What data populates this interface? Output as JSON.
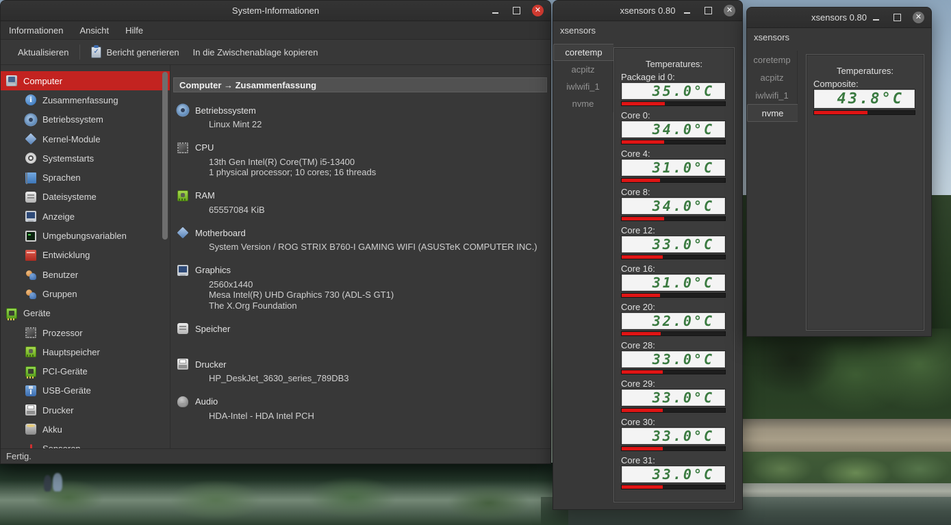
{
  "colors": {
    "accent_red": "#c32320",
    "bar_red": "#e01414",
    "seg_green": "#3a7a40",
    "window_bg": "#383838"
  },
  "main_window": {
    "title": "System-Informationen",
    "menu": [
      "Informationen",
      "Ansicht",
      "Hilfe"
    ],
    "toolbar": {
      "refresh": "Aktualisieren",
      "report": "Bericht generieren",
      "copy": "In die Zwischenablage kopieren"
    },
    "sidebar": [
      {
        "label": "Computer",
        "icon": "computer",
        "indent": 0,
        "selected": true
      },
      {
        "label": "Zusammenfassung",
        "icon": "info",
        "indent": 1
      },
      {
        "label": "Betriebssystem",
        "icon": "gear",
        "indent": 1
      },
      {
        "label": "Kernel-Module",
        "icon": "kernel",
        "indent": 1
      },
      {
        "label": "Systemstarts",
        "icon": "power",
        "indent": 1
      },
      {
        "label": "Sprachen",
        "icon": "lang",
        "indent": 1
      },
      {
        "label": "Dateisysteme",
        "icon": "drive",
        "indent": 1
      },
      {
        "label": "Anzeige",
        "icon": "display",
        "indent": 1
      },
      {
        "label": "Umgebungsvariablen",
        "icon": "terminal",
        "indent": 1
      },
      {
        "label": "Entwicklung",
        "icon": "devel",
        "indent": 1
      },
      {
        "label": "Benutzer",
        "icon": "users",
        "indent": 1
      },
      {
        "label": "Gruppen",
        "icon": "users",
        "indent": 1
      },
      {
        "label": "Geräte",
        "icon": "chip",
        "indent": 0
      },
      {
        "label": "Prozessor",
        "icon": "cpu",
        "indent": 1
      },
      {
        "label": "Hauptspeicher",
        "icon": "ram",
        "indent": 1
      },
      {
        "label": "PCI-Geräte",
        "icon": "chip",
        "indent": 1
      },
      {
        "label": "USB-Geräte",
        "icon": "usb",
        "indent": 1
      },
      {
        "label": "Drucker",
        "icon": "printer",
        "indent": 1
      },
      {
        "label": "Akku",
        "icon": "battery",
        "indent": 1
      },
      {
        "label": "Sensoren",
        "icon": "sensor",
        "indent": 1
      }
    ],
    "content": {
      "header": "Computer → Zusammenfassung",
      "groups": [
        {
          "label": "Betriebssystem",
          "icon": "gear",
          "lines": [
            "Linux Mint 22"
          ]
        },
        {
          "label": "CPU",
          "icon": "cpu",
          "lines": [
            "13th Gen Intel(R) Core(TM) i5-13400",
            "1 physical processor; 10 cores; 16 threads"
          ]
        },
        {
          "label": "RAM",
          "icon": "ram",
          "lines": [
            "65557084 KiB"
          ]
        },
        {
          "label": "Motherboard",
          "icon": "kernel",
          "lines": [
            "System Version / ROG STRIX B760-I GAMING WIFI (ASUSTeK COMPUTER INC.)"
          ]
        },
        {
          "label": "Graphics",
          "icon": "display",
          "lines": [
            "2560x1440",
            "Mesa Intel(R) UHD Graphics 730 (ADL-S GT1)",
            "The X.Org Foundation"
          ]
        },
        {
          "label": "Speicher",
          "icon": "drive",
          "lines": [],
          "spacer": true
        },
        {
          "label": "Drucker",
          "icon": "printer",
          "lines": [
            "HP_DeskJet_3630_series_789DB3"
          ]
        },
        {
          "label": "Audio",
          "icon": "audio",
          "lines": [
            "HDA-Intel - HDA Intel PCH"
          ]
        }
      ]
    },
    "statusbar": "Fertig."
  },
  "xsensors1": {
    "title": "xsensors 0.80",
    "menu": "xsensors",
    "tabs": [
      "coretemp",
      "acpitz",
      "iwlwifi_1",
      "nvme"
    ],
    "active_tab": "coretemp",
    "heading": "Temperatures:",
    "sensors": [
      {
        "label": "Package id 0:",
        "value": "35.0°C",
        "fill": 42
      },
      {
        "label": "Core 0:",
        "value": "34.0°C",
        "fill": 41
      },
      {
        "label": "Core 4:",
        "value": "31.0°C",
        "fill": 37
      },
      {
        "label": "Core 8:",
        "value": "34.0°C",
        "fill": 41
      },
      {
        "label": "Core 12:",
        "value": "33.0°C",
        "fill": 40
      },
      {
        "label": "Core 16:",
        "value": "31.0°C",
        "fill": 37
      },
      {
        "label": "Core 20:",
        "value": "32.0°C",
        "fill": 38
      },
      {
        "label": "Core 28:",
        "value": "33.0°C",
        "fill": 40
      },
      {
        "label": "Core 29:",
        "value": "33.0°C",
        "fill": 40
      },
      {
        "label": "Core 30:",
        "value": "33.0°C",
        "fill": 40
      },
      {
        "label": "Core 31:",
        "value": "33.0°C",
        "fill": 40
      }
    ]
  },
  "xsensors2": {
    "title": "xsensors 0.80",
    "menu": "xsensors",
    "tabs": [
      "coretemp",
      "acpitz",
      "iwlwifi_1",
      "nvme"
    ],
    "active_tab": "nvme",
    "heading": "Temperatures:",
    "sensors": [
      {
        "label": "Composite:",
        "value": "43.8°C",
        "fill": 53
      }
    ]
  }
}
